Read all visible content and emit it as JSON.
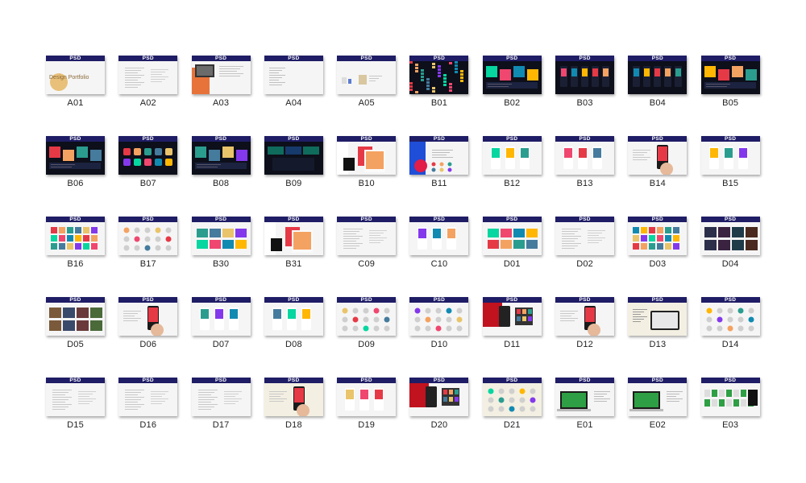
{
  "badge": "PSD",
  "a01_title": "Design Portfolio",
  "items": [
    {
      "label": "A01",
      "theme": "light",
      "art": "title"
    },
    {
      "label": "A02",
      "theme": "light",
      "art": "text"
    },
    {
      "label": "A03",
      "theme": "light",
      "art": "photo-orange"
    },
    {
      "label": "A04",
      "theme": "light",
      "art": "list"
    },
    {
      "label": "A05",
      "theme": "light",
      "art": "small-panels"
    },
    {
      "label": "B01",
      "theme": "dark",
      "art": "neon"
    },
    {
      "label": "B02",
      "theme": "dark",
      "art": "dark-blocks"
    },
    {
      "label": "B03",
      "theme": "dark",
      "art": "dark-phones"
    },
    {
      "label": "B04",
      "theme": "dark",
      "art": "dark-phones"
    },
    {
      "label": "B05",
      "theme": "dark",
      "art": "dark-blocks"
    },
    {
      "label": "B06",
      "theme": "dark",
      "art": "dark-blocks"
    },
    {
      "label": "B07",
      "theme": "dark",
      "art": "dark-icons"
    },
    {
      "label": "B08",
      "theme": "dark",
      "art": "dark-blocks"
    },
    {
      "label": "B09",
      "theme": "dark",
      "art": "dark-cards"
    },
    {
      "label": "B10",
      "theme": "light",
      "art": "device-color"
    },
    {
      "label": "B11",
      "theme": "light",
      "art": "blue-red"
    },
    {
      "label": "B12",
      "theme": "light",
      "art": "phones"
    },
    {
      "label": "B13",
      "theme": "light",
      "art": "phones"
    },
    {
      "label": "B14",
      "theme": "light",
      "art": "hand"
    },
    {
      "label": "B15",
      "theme": "light",
      "art": "phones"
    },
    {
      "label": "B16",
      "theme": "light",
      "art": "swatches"
    },
    {
      "label": "B17",
      "theme": "light",
      "art": "icons"
    },
    {
      "label": "B30",
      "theme": "light",
      "art": "colorful"
    },
    {
      "label": "B31",
      "theme": "light",
      "art": "device-color"
    },
    {
      "label": "C09",
      "theme": "light",
      "art": "text"
    },
    {
      "label": "C10",
      "theme": "light",
      "art": "phones"
    },
    {
      "label": "D01",
      "theme": "light",
      "art": "colorful"
    },
    {
      "label": "D02",
      "theme": "light",
      "art": "text"
    },
    {
      "label": "D03",
      "theme": "light",
      "art": "swatches"
    },
    {
      "label": "D04",
      "theme": "light",
      "art": "dark-grid"
    },
    {
      "label": "D05",
      "theme": "light",
      "art": "photo-grid"
    },
    {
      "label": "D06",
      "theme": "light",
      "art": "hand"
    },
    {
      "label": "D07",
      "theme": "light",
      "art": "phones"
    },
    {
      "label": "D08",
      "theme": "light",
      "art": "phones"
    },
    {
      "label": "D09",
      "theme": "light",
      "art": "icons"
    },
    {
      "label": "D10",
      "theme": "light",
      "art": "icons"
    },
    {
      "label": "D11",
      "theme": "light",
      "art": "red-device"
    },
    {
      "label": "D12",
      "theme": "light",
      "art": "hand"
    },
    {
      "label": "D13",
      "theme": "cream",
      "art": "device-bw"
    },
    {
      "label": "D14",
      "theme": "light",
      "art": "icons"
    },
    {
      "label": "D15",
      "theme": "light",
      "art": "text"
    },
    {
      "label": "D16",
      "theme": "light",
      "art": "text"
    },
    {
      "label": "D17",
      "theme": "light",
      "art": "text"
    },
    {
      "label": "D18",
      "theme": "cream",
      "art": "hand"
    },
    {
      "label": "D19",
      "theme": "light",
      "art": "phones"
    },
    {
      "label": "D20",
      "theme": "light",
      "art": "red-device"
    },
    {
      "label": "D21",
      "theme": "cream",
      "art": "icons"
    },
    {
      "label": "E01",
      "theme": "light",
      "art": "laptop-green"
    },
    {
      "label": "E02",
      "theme": "light",
      "art": "laptop-green"
    },
    {
      "label": "E03",
      "theme": "light",
      "art": "green-grid"
    }
  ]
}
